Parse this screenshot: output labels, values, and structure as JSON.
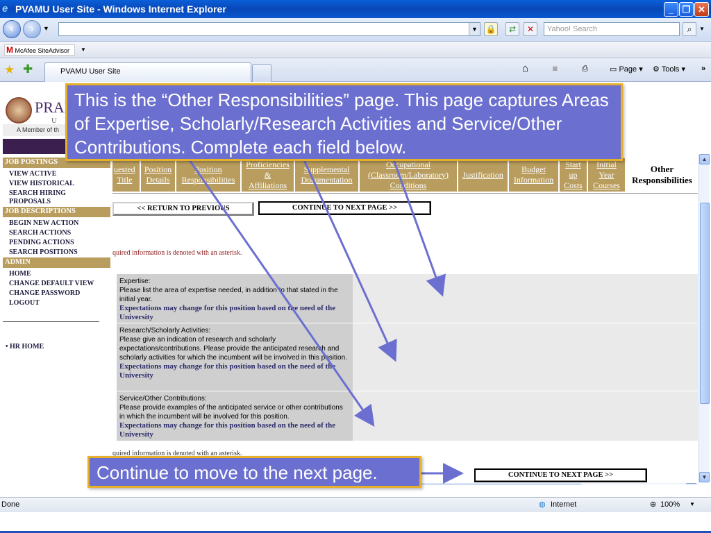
{
  "window": {
    "title": "PVAMU User Site - Windows Internet Explorer"
  },
  "toolbar": {
    "search_placeholder": "Yahoo! Search",
    "mcafee_label": "McAfee SiteAdvisor",
    "tab_label": "PVAMU User Site",
    "page_label": "Page",
    "tools_label": "Tools"
  },
  "sidebar": {
    "logo_text": "PRAI",
    "logo_sub": "U N",
    "member_text": "A Member of th",
    "sections": [
      {
        "title": "JOB POSTINGS",
        "items": [
          "VIEW ACTIVE",
          "VIEW HISTORICAL",
          "SEARCH HIRING PROPOSALS"
        ]
      },
      {
        "title": "JOB DESCRIPTIONS",
        "items": [
          "BEGIN NEW ACTION",
          "SEARCH ACTIONS",
          "PENDING ACTIONS",
          "SEARCH POSITIONS"
        ]
      },
      {
        "title": "ADMIN",
        "items": [
          "HOME",
          "CHANGE DEFAULT VIEW",
          "CHANGE PASSWORD",
          "LOGOUT"
        ]
      }
    ],
    "hr_home": "HR HOME"
  },
  "tabs": [
    {
      "label": "uested\nTitle"
    },
    {
      "label": "Position\nDetails"
    },
    {
      "label": "Position\nResponsibilities"
    },
    {
      "label": "Proficiencies\n&\nAffiliations"
    },
    {
      "label": "Supplemental\nDocumentation"
    },
    {
      "label": "Occupational\n(Classroom/Laboratory)\nConditions"
    },
    {
      "label": "Justification"
    },
    {
      "label": "Budget\nInformation"
    },
    {
      "label": "Start\nup\nCosts"
    },
    {
      "label": "Initial\nYear\nCourses"
    },
    {
      "label": "Other\nResponsibilities"
    }
  ],
  "buttons": {
    "return_previous": "<< RETURN TO PREVIOUS",
    "continue_next": "CONTINUE TO NEXT PAGE >>"
  },
  "required_note": "quired information is denoted with an asterisk.",
  "required_note_bottom": "quired information is denoted with an asterisk.",
  "fields": [
    {
      "title": "Expertise:",
      "desc": "Please list the area of expertise needed, in addition to that stated in the initial year.",
      "note": "Expectations may change for this position based on the need of the University"
    },
    {
      "title": "Research/Scholarly Activities:",
      "desc": "Please give an indication of research and scholarly expectations/contributions. Please provide the anticipated research and scholarly activities for which the incumbent will be involved in this position.",
      "note": "Expectations may change for this position based on the need of the University"
    },
    {
      "title": "Service/Other Contributions:",
      "desc": "Please provide examples of the anticipated service or other contributions in which the incumbent will be involved for this position.",
      "note": "Expectations may change for this position based on the need of the University"
    }
  ],
  "status": {
    "left": "Done",
    "zone": "Internet",
    "zoom": "100%"
  },
  "callouts": {
    "top": "This is the “Other Responsibilities” page. This page captures Areas of Expertise, Scholarly/Research Activities and Service/Other Contributions. Complete each field below.",
    "bottom": "Continue to move to the next page."
  },
  "colors": {
    "accent": "#b99d5e",
    "callout_bg": "#6b6fcf",
    "callout_border": "#e7b02a",
    "arrow": "#6b6fcf"
  }
}
